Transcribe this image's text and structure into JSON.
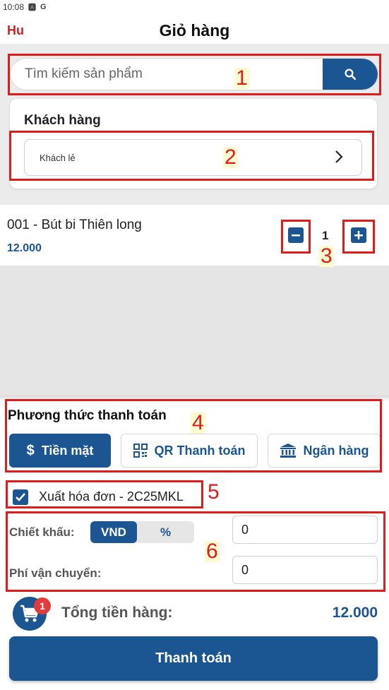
{
  "status_bar": {
    "time": "10:08",
    "icons": [
      "a-icon",
      "google-icon"
    ]
  },
  "header": {
    "back_label": "Hu",
    "title": "Giỏ hàng"
  },
  "search": {
    "placeholder": "Tìm kiếm sản phẩm",
    "value": ""
  },
  "customer": {
    "label": "Khách hàng",
    "value": "Khách lẻ"
  },
  "cart_items": [
    {
      "name": "001 - Bút bi Thiên long",
      "price": "12.000",
      "quantity": "1"
    }
  ],
  "payment": {
    "title": "Phương thức thanh toán",
    "methods": [
      {
        "label": "Tiền mặt",
        "icon": "dollar-icon",
        "selected": true
      },
      {
        "label": "QR Thanh toán",
        "icon": "qr-code-icon",
        "selected": false
      },
      {
        "label": "Ngân hàng",
        "icon": "bank-icon",
        "selected": false
      }
    ]
  },
  "invoice": {
    "label": "Xuất hóa đơn - 2C25MKL",
    "checked": true
  },
  "discount": {
    "label": "Chiết khấu:",
    "unit_options": [
      "VND",
      "%"
    ],
    "selected_unit": "VND",
    "value": "0"
  },
  "shipping": {
    "label": "Phí vận chuyển:",
    "value": "0"
  },
  "summary": {
    "cart_count": "1",
    "total_label": "Tổng tiền hàng:",
    "total_value": "12.000"
  },
  "checkout_label": "Thanh toán",
  "annotations": [
    "1",
    "2",
    "3",
    "4",
    "5",
    "6"
  ],
  "colors": {
    "primary": "#1b5592",
    "annotation": "#e01b1b",
    "badge": "#e23b3b"
  }
}
